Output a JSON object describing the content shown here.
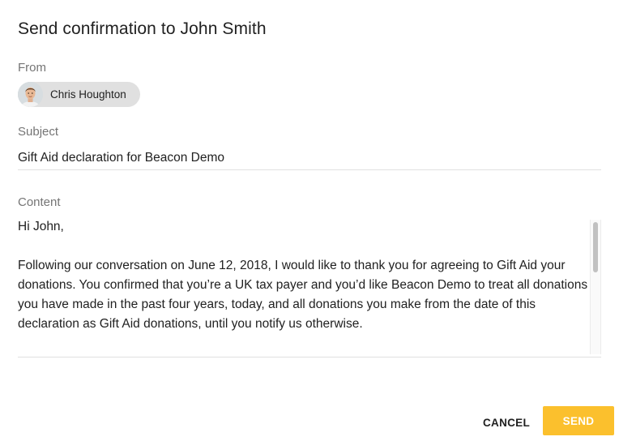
{
  "dialog": {
    "title": "Send confirmation to John Smith"
  },
  "from": {
    "label": "From",
    "sender_name": "Chris Houghton",
    "avatar_icon": "person-avatar"
  },
  "subject": {
    "label": "Subject",
    "value": "Gift Aid declaration for Beacon Demo"
  },
  "content": {
    "label": "Content",
    "paragraphs": [
      "Hi John,",
      "Following our conversation on June 12, 2018, I would like to thank you for agreeing to Gift Aid your donations. You confirmed that you’re a UK tax payer and you’d like Beacon Demo to treat all donations you have made in the past four years, today, and all donations you make from the date of this declaration as Gift Aid donations, until you notify us otherwise."
    ]
  },
  "actions": {
    "cancel_label": "CANCEL",
    "send_label": "SEND"
  },
  "colors": {
    "send_button": "#fbc02d",
    "chip_background": "#e0e0e0",
    "label_text": "#757575"
  }
}
